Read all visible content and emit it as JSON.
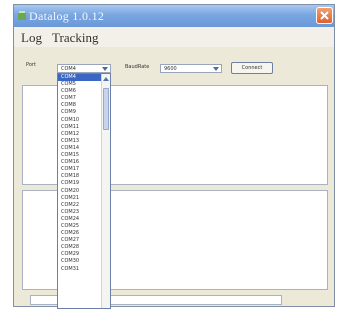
{
  "window": {
    "title": "Datalog 1.0.12",
    "title_color": "#f4f8ff",
    "close_color": "#e06030"
  },
  "menu": {
    "items": [
      "Log",
      "Tracking"
    ]
  },
  "toolbar": {
    "port_label": "Port",
    "port_value": "COM4",
    "baud_label": "BaudRate",
    "baud_value": "9600",
    "connect_label": "Connect"
  },
  "port_dropdown": {
    "selected_index": 0,
    "selected_color": "#3a66c4",
    "options": [
      "COM4",
      "COM5",
      "COM6",
      "COM7",
      "COM8",
      "COM9",
      "COM10",
      "COM11",
      "COM12",
      "COM13",
      "COM14",
      "COM15",
      "COM16",
      "COM17",
      "COM18",
      "COM19",
      "COM20",
      "COM21",
      "COM22",
      "COM23",
      "COM24",
      "COM25",
      "COM26",
      "COM27",
      "COM28",
      "COM29",
      "COM30",
      "COM31"
    ]
  }
}
